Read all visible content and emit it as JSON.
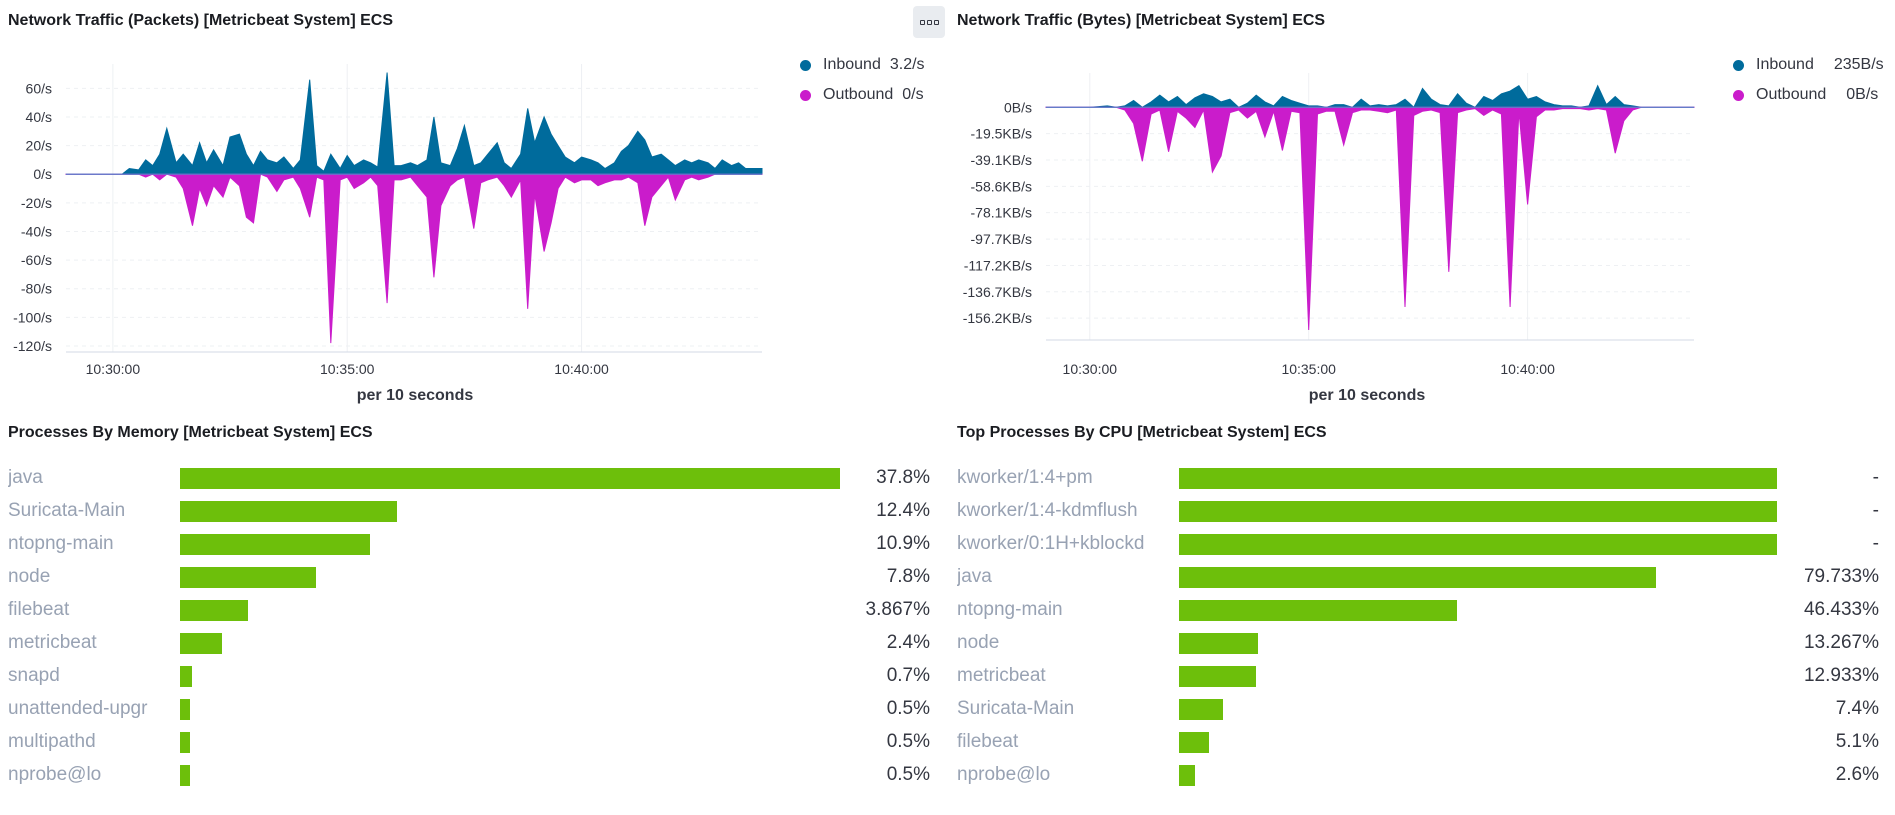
{
  "panels": {
    "packets": {
      "title": "Network Traffic (Packets) [Metricbeat System] ECS",
      "per_label": "per 10 seconds",
      "legend": [
        {
          "label": "Inbound",
          "value": "3.2/s",
          "color": "#006b9c"
        },
        {
          "label": "Outbound",
          "value": "0/s",
          "color": "#ca1ccb"
        }
      ]
    },
    "bytes": {
      "title": "Network Traffic (Bytes) [Metricbeat System] ECS",
      "per_label": "per 10 seconds",
      "legend": [
        {
          "label": "Inbound",
          "value": "235B/s",
          "color": "#006b9c"
        },
        {
          "label": "Outbound",
          "value": "0B/s",
          "color": "#ca1ccb"
        }
      ]
    },
    "memory": {
      "title": "Processes By Memory [Metricbeat System] ECS"
    },
    "cpu": {
      "title": "Top Processes By CPU [Metricbeat System] ECS"
    }
  },
  "chart_data": [
    {
      "type": "area",
      "title": "Network Traffic (Packets) [Metricbeat System] ECS",
      "xlabel": "per 10 seconds",
      "ylabel": "",
      "x_ticks": [
        "10:30:00",
        "10:35:00",
        "10:40:00"
      ],
      "y_ticks": [
        "60/s",
        "40/s",
        "20/s",
        "0/s",
        "-20/s",
        "-40/s",
        "-60/s",
        "-80/s",
        "-100/s",
        "-120/s"
      ],
      "ylim": [
        -120,
        70
      ],
      "x_unit": "minutes since 10:29",
      "x": [
        0,
        0.83,
        1.0,
        1.2,
        1.35,
        1.55,
        1.7,
        1.85,
        2.0,
        2.15,
        2.35,
        2.5,
        2.7,
        2.85,
        3.0,
        3.15,
        3.35,
        3.5,
        3.7,
        3.85,
        4.0,
        4.15,
        4.3,
        4.5,
        4.65,
        4.85,
        5.0,
        5.2,
        5.35,
        5.5,
        5.65,
        5.85,
        6.0,
        6.15,
        6.35,
        6.5,
        6.65,
        6.85,
        7.0,
        7.15,
        7.35,
        7.5,
        7.7,
        7.85,
        8.0,
        8.2,
        8.35,
        8.5,
        8.7,
        8.85,
        9.0,
        9.2,
        9.35,
        9.5,
        9.7,
        9.85,
        10.0,
        10.2,
        10.35,
        10.5,
        10.65,
        10.85,
        11.0,
        11.2,
        11.35,
        11.5,
        11.7,
        11.85,
        12.0,
        12.2,
        12.35,
        12.5,
        12.7,
        12.85,
        13.0,
        13.2,
        13.35,
        13.5,
        13.7,
        13.85,
        14.0,
        14.2,
        14.35,
        14.5,
        14.7,
        14.85
      ],
      "series": [
        {
          "name": "Inbound",
          "values": [
            0,
            0,
            0,
            0,
            4,
            3,
            10,
            6,
            14,
            32,
            8,
            14,
            6,
            22,
            8,
            17,
            6,
            26,
            28,
            14,
            6,
            16,
            10,
            8,
            12,
            4,
            10,
            66,
            6,
            2,
            14,
            4,
            13,
            6,
            10,
            8,
            5,
            71,
            6,
            6,
            8,
            6,
            10,
            40,
            8,
            6,
            18,
            34,
            6,
            8,
            14,
            22,
            8,
            4,
            14,
            46,
            22,
            40,
            28,
            20,
            12,
            8,
            12,
            10,
            8,
            4,
            8,
            16,
            20,
            30,
            24,
            12,
            14,
            10,
            6,
            10,
            8,
            10,
            8,
            4,
            10,
            6,
            8,
            4,
            4,
            4
          ]
        },
        {
          "name": "Outbound",
          "values": [
            0,
            0,
            0,
            0,
            0,
            0,
            -2,
            0,
            -4,
            0,
            -2,
            -10,
            -36,
            -10,
            -22,
            -8,
            -16,
            -2,
            -8,
            -30,
            -34,
            0,
            -2,
            -12,
            -4,
            -2,
            -10,
            -30,
            -2,
            -4,
            -118,
            -4,
            -2,
            -10,
            -6,
            -2,
            -8,
            -90,
            -4,
            -4,
            -2,
            -8,
            -16,
            -72,
            -22,
            -8,
            -4,
            -2,
            -38,
            -6,
            -4,
            -2,
            -8,
            -16,
            -4,
            -94,
            -14,
            -54,
            -34,
            -10,
            -2,
            -6,
            -4,
            -4,
            -8,
            -6,
            -4,
            -4,
            -2,
            -6,
            -36,
            -16,
            -8,
            -2,
            -18,
            -4,
            -2,
            -4,
            -2,
            0,
            0,
            0,
            0,
            0,
            0,
            0
          ]
        }
      ]
    },
    {
      "type": "area",
      "title": "Network Traffic (Bytes) [Metricbeat System] ECS",
      "xlabel": "per 10 seconds",
      "ylabel": "",
      "x_ticks": [
        "10:30:00",
        "10:35:00",
        "10:40:00"
      ],
      "y_ticks": [
        "0B/s",
        "-19.5KB/s",
        "-39.1KB/s",
        "-58.6KB/s",
        "-78.1KB/s",
        "-97.7KB/s",
        "-117.2KB/s",
        "-136.7KB/s",
        "-156.2KB/s"
      ],
      "ylim": [
        -168,
        18
      ],
      "y_unit": "KB/s",
      "x_unit": "minutes since 10:29",
      "x": [
        0,
        1.0,
        1.2,
        1.4,
        1.6,
        1.8,
        2.0,
        2.2,
        2.4,
        2.6,
        2.8,
        3.0,
        3.2,
        3.4,
        3.6,
        3.8,
        4.0,
        4.2,
        4.4,
        4.6,
        4.8,
        5.0,
        5.2,
        5.4,
        5.6,
        5.8,
        6.0,
        6.2,
        6.4,
        6.6,
        6.8,
        7.0,
        7.2,
        7.4,
        7.6,
        7.8,
        8.0,
        8.2,
        8.4,
        8.6,
        8.8,
        9.0,
        9.2,
        9.4,
        9.6,
        9.8,
        10.0,
        10.2,
        10.4,
        10.6,
        10.8,
        11.0,
        11.2,
        11.4,
        11.6,
        11.8,
        12.0,
        12.2,
        12.4,
        12.6,
        12.8,
        13.0,
        13.2,
        13.4,
        13.6,
        13.8,
        14.0,
        14.2,
        14.4,
        14.6,
        14.8
      ],
      "series": [
        {
          "name": "Inbound",
          "values": [
            0,
            0,
            0.5,
            1,
            0,
            1,
            5,
            0,
            4,
            9,
            4,
            8,
            2,
            7,
            10,
            8,
            4,
            6,
            0,
            3,
            9,
            4,
            1,
            8,
            5,
            3,
            1,
            1,
            0,
            2,
            2,
            0,
            6,
            1,
            2,
            1,
            2,
            6,
            0,
            14,
            6,
            2,
            1,
            10,
            3,
            0,
            8,
            5,
            10,
            12,
            16,
            6,
            8,
            4,
            2,
            1,
            1,
            0,
            1,
            16,
            2,
            8,
            2,
            1,
            0,
            0,
            0,
            0,
            0,
            0,
            0
          ]
        },
        {
          "name": "Outbound",
          "values": [
            0,
            0,
            0,
            0,
            0,
            -2,
            -12,
            -40,
            -5,
            -2,
            -33,
            -3,
            -8,
            -15,
            -2,
            -48,
            -36,
            -4,
            -2,
            -8,
            -3,
            -22,
            -3,
            -32,
            -3,
            -4,
            -165,
            -5,
            -3,
            -3,
            -28,
            -4,
            -2,
            -2,
            -3,
            -4,
            -2,
            -148,
            -6,
            -3,
            -2,
            -4,
            -122,
            -4,
            -2,
            -1,
            -6,
            -2,
            -5,
            -148,
            -3,
            -72,
            -7,
            -2,
            -2,
            -1,
            -1,
            -1,
            -2,
            -1,
            -2,
            -34,
            -10,
            -2,
            0,
            0,
            0,
            0,
            0,
            0,
            0
          ]
        }
      ]
    },
    {
      "type": "bar",
      "title": "Processes By Memory [Metricbeat System] ECS",
      "categories": [
        "java",
        "Suricata-Main",
        "ntopng-main",
        "node",
        "filebeat",
        "metricbeat",
        "snapd",
        "unattended-upgr",
        "multipathd",
        "nprobe@lo"
      ],
      "values": [
        37.8,
        12.4,
        10.9,
        7.8,
        3.867,
        2.4,
        0.7,
        0.5,
        0.5,
        0.5
      ],
      "labels": [
        "37.8%",
        "12.4%",
        "10.9%",
        "7.8%",
        "3.867%",
        "2.4%",
        "0.7%",
        "0.5%",
        "0.5%",
        "0.5%"
      ],
      "max": 37.8,
      "bar_color": "#6dbf0b"
    },
    {
      "type": "bar",
      "title": "Top Processes By CPU [Metricbeat System] ECS",
      "categories": [
        "kworker/1:4+pm",
        "kworker/1:4-kdmflush",
        "kworker/0:1H+kblockd",
        "java",
        "ntopng-main",
        "node",
        "metricbeat",
        "Suricata-Main",
        "filebeat",
        "nprobe@lo"
      ],
      "values": [
        100,
        100,
        100,
        79.733,
        46.433,
        13.267,
        12.933,
        7.4,
        5.1,
        2.6
      ],
      "labels": [
        "-",
        "-",
        "-",
        "79.733%",
        "46.433%",
        "13.267%",
        "12.933%",
        "7.4%",
        "5.1%",
        "2.6%"
      ],
      "max": 100,
      "bar_color": "#6dbf0b"
    }
  ]
}
